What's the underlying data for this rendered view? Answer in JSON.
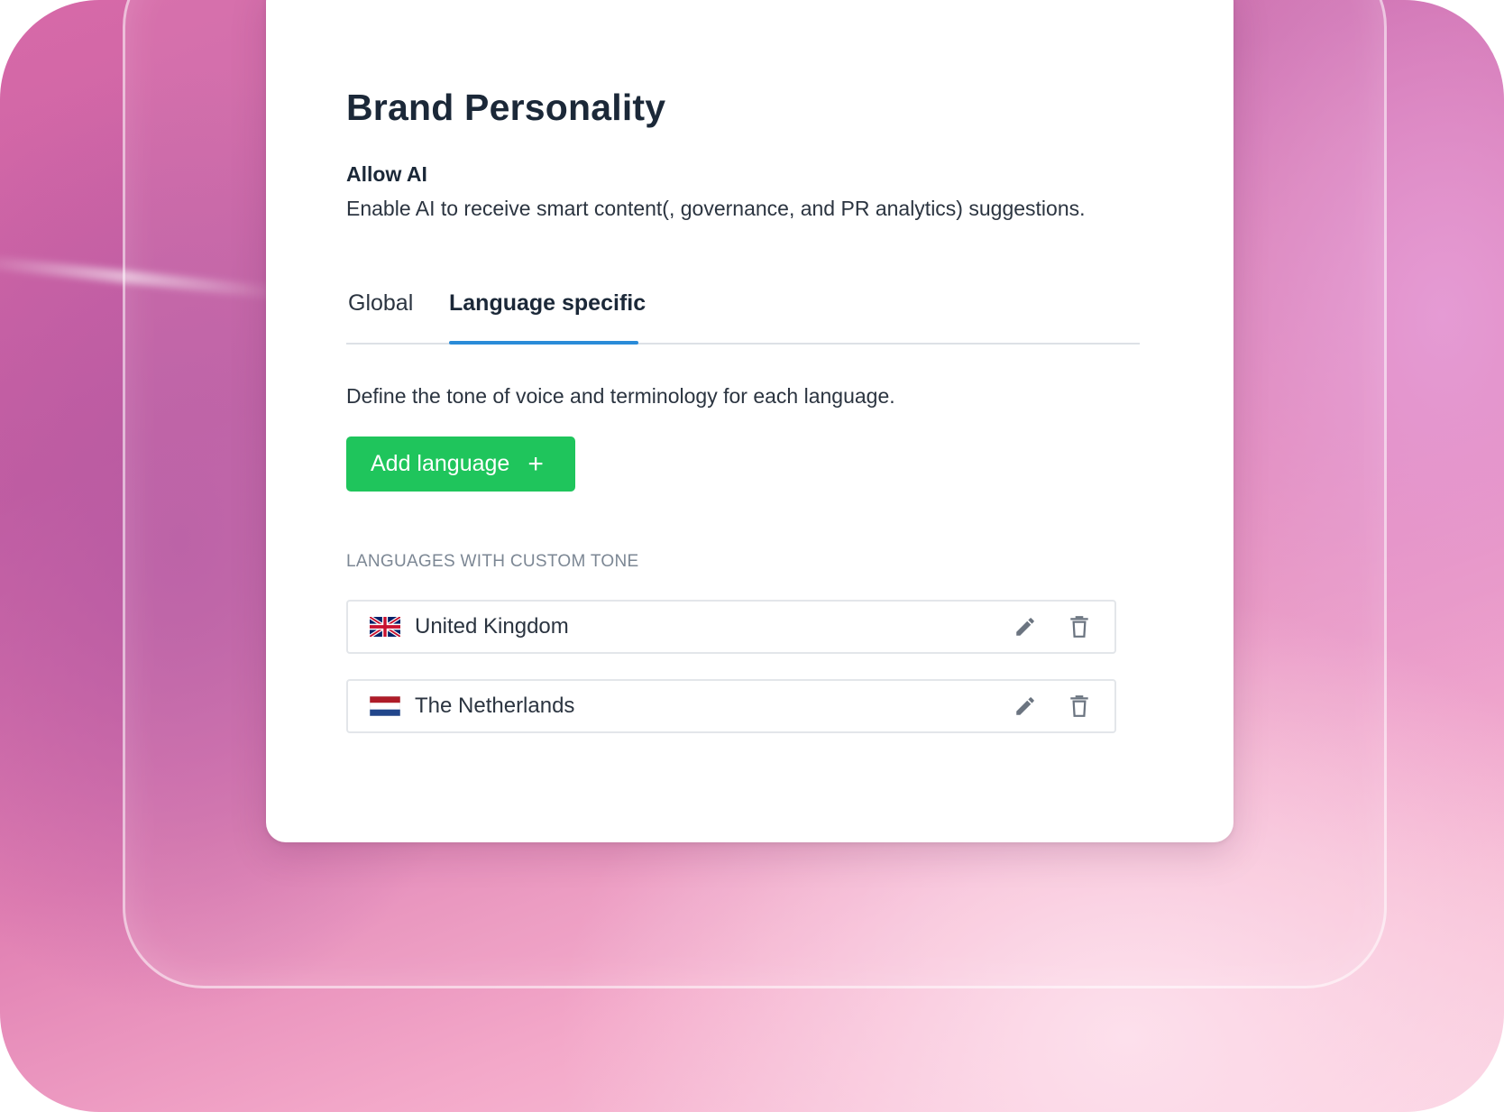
{
  "page": {
    "title": "Brand Personality"
  },
  "allow_ai": {
    "label": "Allow AI",
    "description": "Enable AI to receive smart content(, governance, and PR analytics) suggestions."
  },
  "tabs": [
    {
      "label": "Global",
      "active": false
    },
    {
      "label": "Language specific",
      "active": true
    }
  ],
  "language_specific": {
    "description": "Define the tone of voice and terminology for each language.",
    "add_button_label": "Add language",
    "add_button_icon": "plus-icon",
    "section_label": "LANGUAGES WITH CUSTOM TONE",
    "languages": [
      {
        "name": "United Kingdom",
        "flag_icon": "uk-flag-icon"
      },
      {
        "name": "The Netherlands",
        "flag_icon": "netherlands-flag-icon"
      }
    ],
    "row_actions": [
      "pencil-icon",
      "trash-icon"
    ]
  },
  "colors": {
    "primary_button": "#1fc55c",
    "active_tab_underline": "#2a8bd8",
    "heading_text": "#1b2838",
    "muted_text": "#7c8794"
  }
}
